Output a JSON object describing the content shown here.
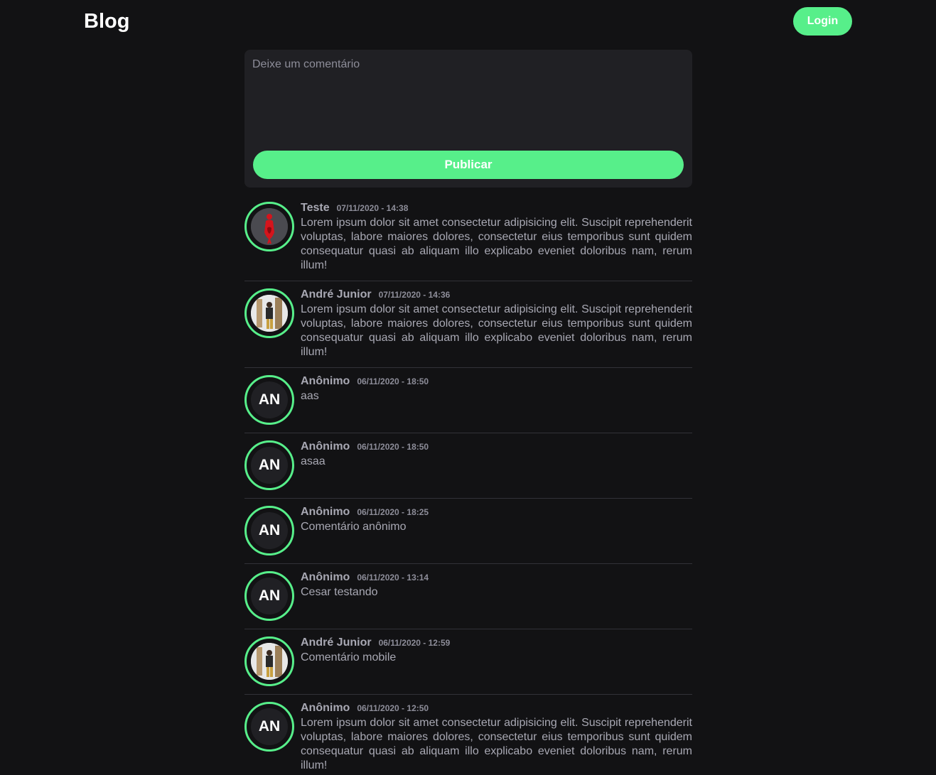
{
  "header": {
    "brand": "Blog",
    "login_label": "Login"
  },
  "composer": {
    "placeholder": "Deixe um comentário",
    "publish_label": "Publicar"
  },
  "colors": {
    "accent": "#57ef8a",
    "background": "#121214",
    "card": "#202024"
  },
  "comments": [
    {
      "author": "Teste",
      "date": "07/11/2020 - 14:38",
      "avatar": "photo-red-icon",
      "text": "Lorem ipsum dolor sit amet consectetur adipisicing elit. Suscipit reprehenderit voluptas, labore maiores dolores, consectetur eius temporibus sunt quidem consequatur quasi ab aliquam illo explicabo eveniet doloribus nam, rerum illum!"
    },
    {
      "author": "André Junior",
      "date": "07/11/2020 - 14:36",
      "avatar": "photo-person-icon",
      "text": "Lorem ipsum dolor sit amet consectetur adipisicing elit. Suscipit reprehenderit voluptas, labore maiores dolores, consectetur eius temporibus sunt quidem consequatur quasi ab aliquam illo explicabo eveniet doloribus nam, rerum illum!"
    },
    {
      "author": "Anônimo",
      "date": "06/11/2020 - 18:50",
      "initials": "AN",
      "text": "aas"
    },
    {
      "author": "Anônimo",
      "date": "06/11/2020 - 18:50",
      "initials": "AN",
      "text": "asaa"
    },
    {
      "author": "Anônimo",
      "date": "06/11/2020 - 18:25",
      "initials": "AN",
      "text": "Comentário anônimo"
    },
    {
      "author": "Anônimo",
      "date": "06/11/2020 - 13:14",
      "initials": "AN",
      "text": "Cesar testando"
    },
    {
      "author": "André Junior",
      "date": "06/11/2020 - 12:59",
      "avatar": "photo-person-icon",
      "text": "Comentário mobile"
    },
    {
      "author": "Anônimo",
      "date": "06/11/2020 - 12:50",
      "initials": "AN",
      "text": "Lorem ipsum dolor sit amet consectetur adipisicing elit. Suscipit reprehenderit voluptas, labore maiores dolores, consectetur eius temporibus sunt quidem consequatur quasi ab aliquam illo explicabo eveniet doloribus nam, rerum illum!"
    }
  ]
}
